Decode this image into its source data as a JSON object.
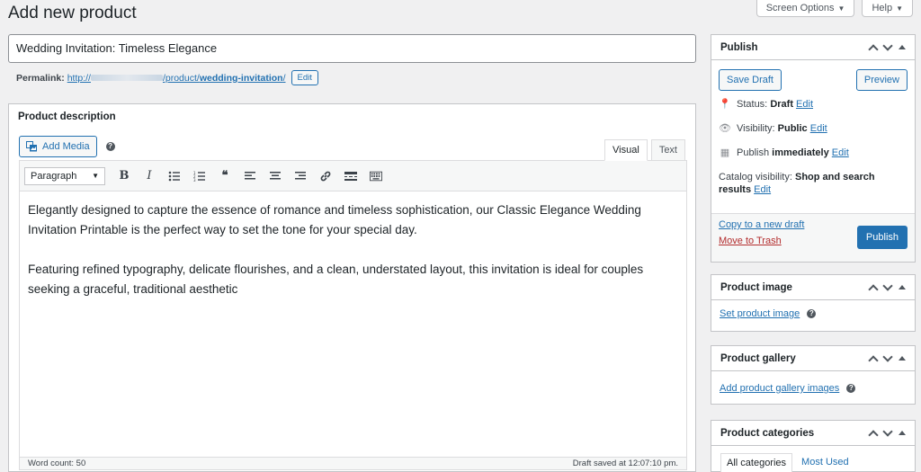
{
  "page_title": "Add new product",
  "screen_options_label": "Screen Options",
  "help_label": "Help",
  "product_title": "Wedding Invitation: Timeless Elegance",
  "permalink": {
    "label": "Permalink:",
    "url_prefix": "http://",
    "url_mid": "/product/",
    "slug": "wedding-invitation",
    "url_suffix": "/",
    "edit_label": "Edit"
  },
  "editor": {
    "title": "Product description",
    "add_media_label": "Add Media",
    "tabs": [
      "Visual",
      "Text"
    ],
    "format_value": "Paragraph",
    "paragraphs": [
      "Elegantly designed to capture the essence of romance and timeless sophistication, our Classic Elegance Wedding Invitation Printable is the perfect way to set the tone for your special day.",
      "Featuring refined typography, delicate flourishes, and a clean, understated layout, this invitation is ideal for couples seeking a graceful, traditional aesthetic"
    ],
    "word_count": "Word count: 50",
    "draft_saved": "Draft saved at 12:07:10 pm."
  },
  "publish": {
    "title": "Publish",
    "save_draft": "Save Draft",
    "preview": "Preview",
    "status_label": "Status:",
    "status_value": "Draft",
    "visibility_label": "Visibility:",
    "visibility_value": "Public",
    "publish_label": "Publish",
    "publish_value": "immediately",
    "catalog_label": "Catalog visibility:",
    "catalog_value": "Shop and search results",
    "edit": "Edit",
    "copy_draft": "Copy to a new draft",
    "trash": "Move to Trash",
    "publish_button": "Publish"
  },
  "product_image": {
    "title": "Product image",
    "link": "Set product image"
  },
  "product_gallery": {
    "title": "Product gallery",
    "link": "Add product gallery images"
  },
  "product_categories": {
    "title": "Product categories",
    "tabs": [
      "All categories",
      "Most Used"
    ]
  },
  "colors": {
    "accent": "#2271b1",
    "trash": "#b32d2e",
    "background": "#f0f0f1"
  }
}
